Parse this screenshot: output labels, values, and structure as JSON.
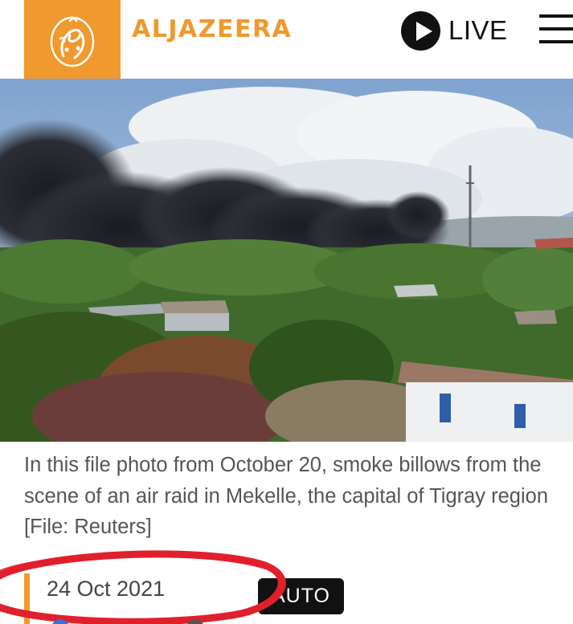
{
  "header": {
    "brand": "ALJAZEERA",
    "live_label": "LIVE"
  },
  "icons": {
    "logo": "aljazeera-calligraphy-logo",
    "live": "play-circle-icon",
    "menu": "hamburger-menu-icon"
  },
  "colors": {
    "brand_orange": "#f0992e",
    "annotation_red": "#e0202c",
    "badge_black": "#111111"
  },
  "article": {
    "caption": "In this file photo from October 20, smoke billows from the scene of an air raid in Mekelle, the capital of Tigray region [File: Reuters]",
    "date": "24 Oct 2021",
    "badge": "AUTO"
  }
}
